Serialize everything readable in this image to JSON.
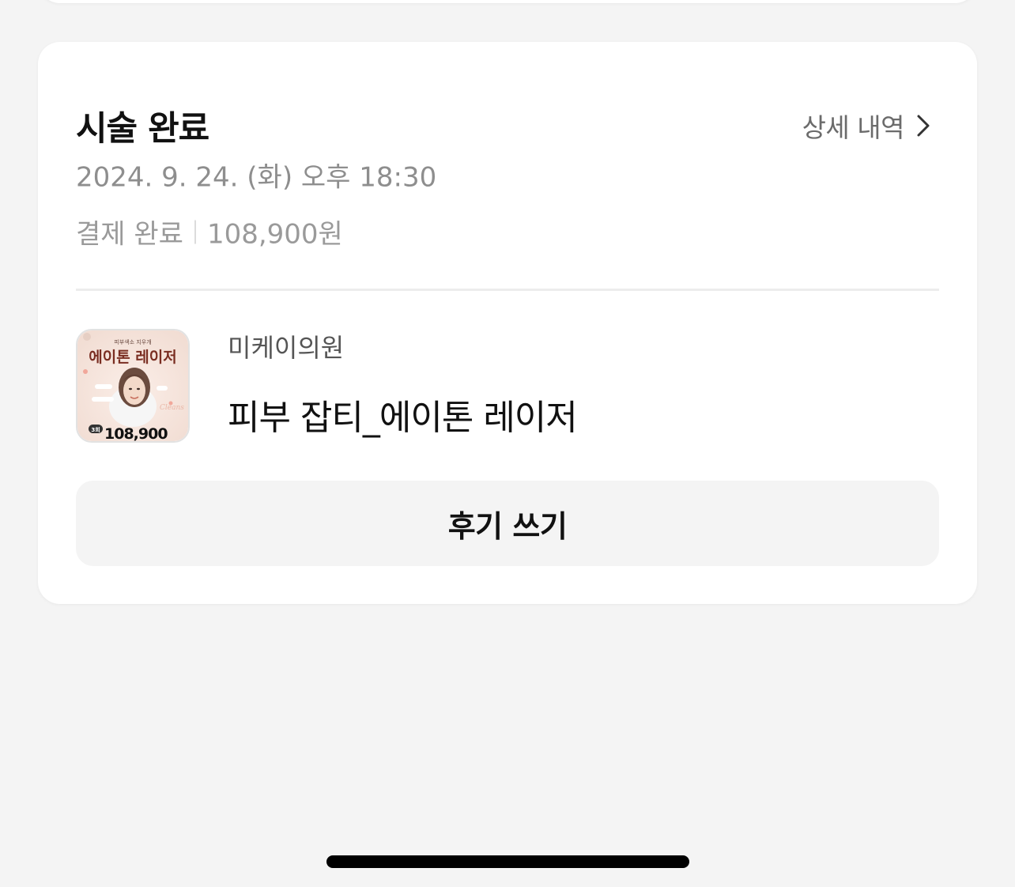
{
  "order_card": {
    "status_title": "시술 완료",
    "detail_link_label": "상세 내역",
    "datetime": "2024. 9. 24. (화) 오후 18:30",
    "payment_status": "결제 완료",
    "payment_amount": "108,900원",
    "item": {
      "clinic_name": "미케이의원",
      "treatment_name": "피부 잡티_에이톤 레이저",
      "thumbnail": {
        "headline_small": "피부색소 지우개",
        "headline": "에이톤 레이저",
        "sessions": "3회",
        "price": "108,900"
      }
    },
    "review_button_label": "후기 쓰기"
  },
  "colors": {
    "background": "#f4f4f4",
    "card": "#ffffff",
    "primary_text": "#111111",
    "secondary_text": "#8e8e8e",
    "thumbnail_headline": "#7a2e22"
  },
  "icons": {
    "detail_link": "chevron-right-icon"
  }
}
